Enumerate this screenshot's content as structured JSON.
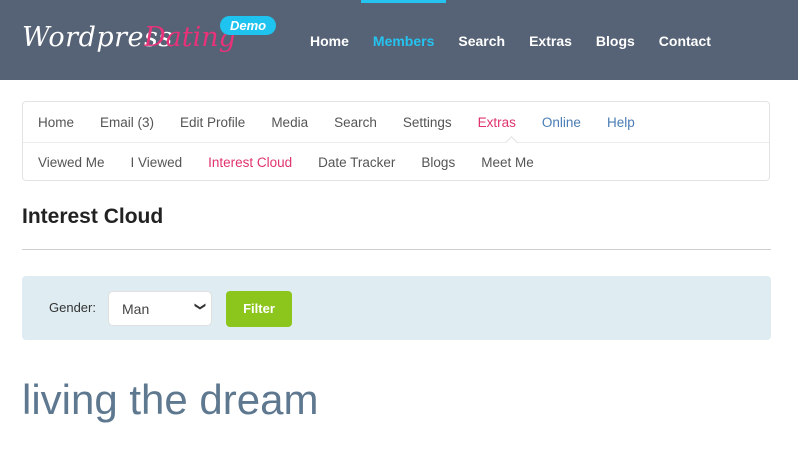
{
  "brand": {
    "word1": "Wordpress",
    "word2": "Dating",
    "badge": "Demo"
  },
  "topnav": {
    "items": [
      {
        "label": "Home"
      },
      {
        "label": "Members",
        "active": true
      },
      {
        "label": "Search"
      },
      {
        "label": "Extras"
      },
      {
        "label": "Blogs"
      },
      {
        "label": "Contact"
      }
    ]
  },
  "subnav": {
    "row1": [
      "Home",
      "Email (3)",
      "Edit Profile",
      "Media",
      "Search",
      "Settings",
      "Extras",
      "Online",
      "Help"
    ],
    "row2": [
      "Viewed Me",
      "I Viewed",
      "Interest Cloud",
      "Date Tracker",
      "Blogs",
      "Meet Me"
    ]
  },
  "page": {
    "title": "Interest Cloud"
  },
  "filter": {
    "gender_label": "Gender:",
    "gender_value": "Man",
    "button_label": "Filter"
  },
  "cloud": {
    "terms": [
      "living the dream"
    ]
  },
  "colors": {
    "header_bg": "#566275",
    "accent_blue": "#25c3ef",
    "accent_pink": "#e0336e",
    "filter_green": "#8cc51c",
    "filter_bar_bg": "#dfedf3"
  }
}
